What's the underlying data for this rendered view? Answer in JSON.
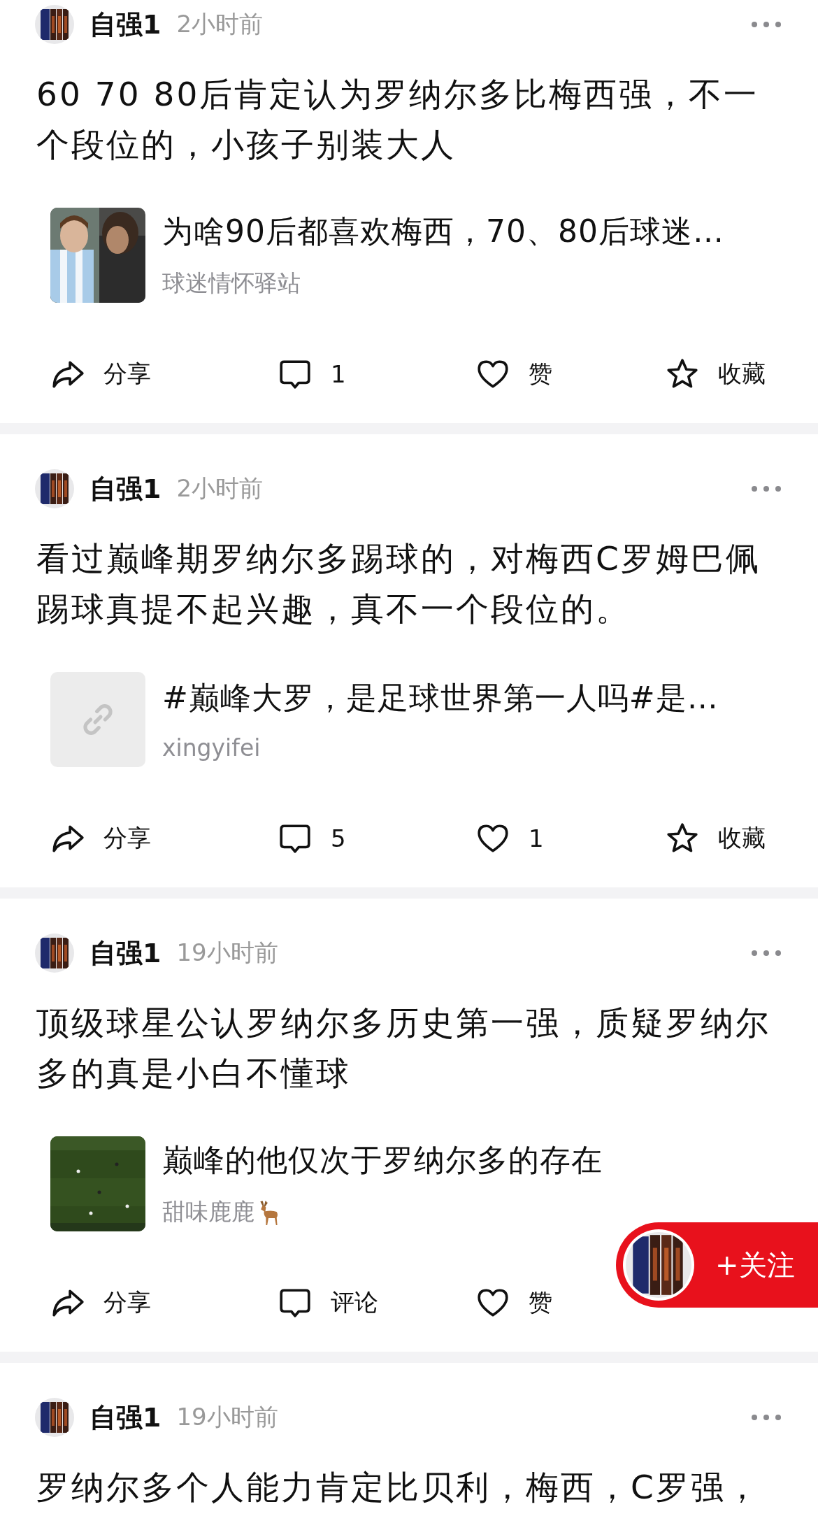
{
  "posts": [
    {
      "author": "自强1",
      "time": "2小时前",
      "text": "60 70 80后肯定认为罗纳尔多比梅西强，不一个段位的，小孩子别装大人",
      "card": {
        "kind": "picture",
        "title": "为啥90后都喜欢梅西，70、80后球迷…",
        "source": "球迷情怀驿站",
        "deer": false
      },
      "actions": [
        {
          "kind": "share",
          "label": "分享"
        },
        {
          "kind": "comment",
          "label": "1"
        },
        {
          "kind": "like",
          "label": "赞"
        },
        {
          "kind": "favorite",
          "label": "收藏"
        }
      ]
    },
    {
      "author": "自强1",
      "time": "2小时前",
      "text": "看过巅峰期罗纳尔多踢球的，对梅西C罗姆巴佩踢球真提不起兴趣，真不一个段位的。",
      "card": {
        "kind": "link",
        "title": "#巅峰大罗，是足球世界第一人吗#是…",
        "source": "xingyifei",
        "deer": false
      },
      "actions": [
        {
          "kind": "share",
          "label": "分享"
        },
        {
          "kind": "comment",
          "label": "5"
        },
        {
          "kind": "like",
          "label": "1"
        },
        {
          "kind": "favorite",
          "label": "收藏"
        }
      ]
    },
    {
      "author": "自强1",
      "time": "19小时前",
      "text": "顶级球星公认罗纳尔多历史第一强，质疑罗纳尔多的真是小白不懂球",
      "card": {
        "kind": "picture",
        "title": "巅峰的他仅次于罗纳尔多的存在",
        "source": "甜味鹿鹿",
        "deer": true
      },
      "actions": [
        {
          "kind": "share",
          "label": "分享"
        },
        {
          "kind": "comment",
          "label": "评论"
        },
        {
          "kind": "like",
          "label": "赞"
        }
      ]
    },
    {
      "author": "自强1",
      "time": "19小时前",
      "text": "罗纳尔多个人能力肯定比贝利，梅西，C罗强，"
    }
  ],
  "follow_button": {
    "label": "+关注"
  }
}
